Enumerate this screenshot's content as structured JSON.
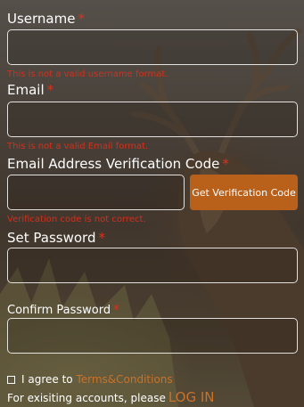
{
  "form": {
    "username": {
      "label": "Username",
      "required_mark": "*",
      "value": "",
      "error": "This is not a valid username format."
    },
    "email": {
      "label": "Email",
      "required_mark": "*",
      "value": "",
      "error": "This is not a valid Email format."
    },
    "verification": {
      "label": "Email Address Verification Code",
      "required_mark": "*",
      "value": "",
      "button_label": "Get Verification Code",
      "error": "Verification code is not correct."
    },
    "password": {
      "label": "Set Password",
      "required_mark": "*",
      "value": ""
    },
    "confirm_password": {
      "label": "Confirm Password",
      "required_mark": "*",
      "value": ""
    },
    "agree": {
      "prefix": "I agree to",
      "link": "Terms&Conditions",
      "checked": false
    },
    "login": {
      "prefix": "For exisiting accounts, please",
      "link": "LOG IN"
    }
  },
  "colors": {
    "accent_button": "#b9601b",
    "link": "#c8722a",
    "error": "#d1301c",
    "required": "#d8341e"
  }
}
